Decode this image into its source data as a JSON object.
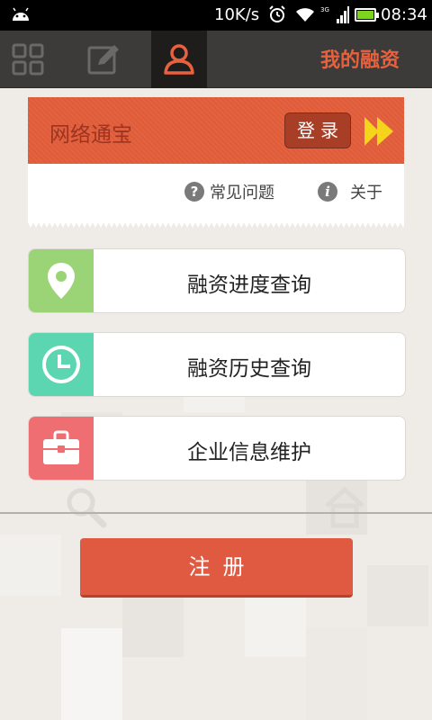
{
  "status_bar": {
    "speed": "10K/s",
    "time": "08:34",
    "battery_level": 1.0,
    "network_badge": "3G"
  },
  "nav": {
    "tabs": [
      {
        "icon": "grid-icon",
        "active": false
      },
      {
        "icon": "edit-icon",
        "active": false
      },
      {
        "icon": "user-icon",
        "active": true
      }
    ],
    "title": "我的融资"
  },
  "login_card": {
    "app_name": "网络通宝",
    "login_label": "登录",
    "faq_label": "常见问题",
    "about_label": "关于",
    "faq_icon_glyph": "?",
    "about_icon_glyph": "i"
  },
  "menu": [
    {
      "label": "融资进度查询",
      "icon": "location-pin-icon",
      "color": "#9bd477"
    },
    {
      "label": "融资历史查询",
      "icon": "clock-icon",
      "color": "#5bd6b0"
    },
    {
      "label": "企业信息维护",
      "icon": "briefcase-icon",
      "color": "#ef6e72"
    }
  ],
  "register_label": "注册",
  "colors": {
    "accent": "#e05a42",
    "nav_bg": "#3d3b39",
    "title": "#e8603d"
  }
}
